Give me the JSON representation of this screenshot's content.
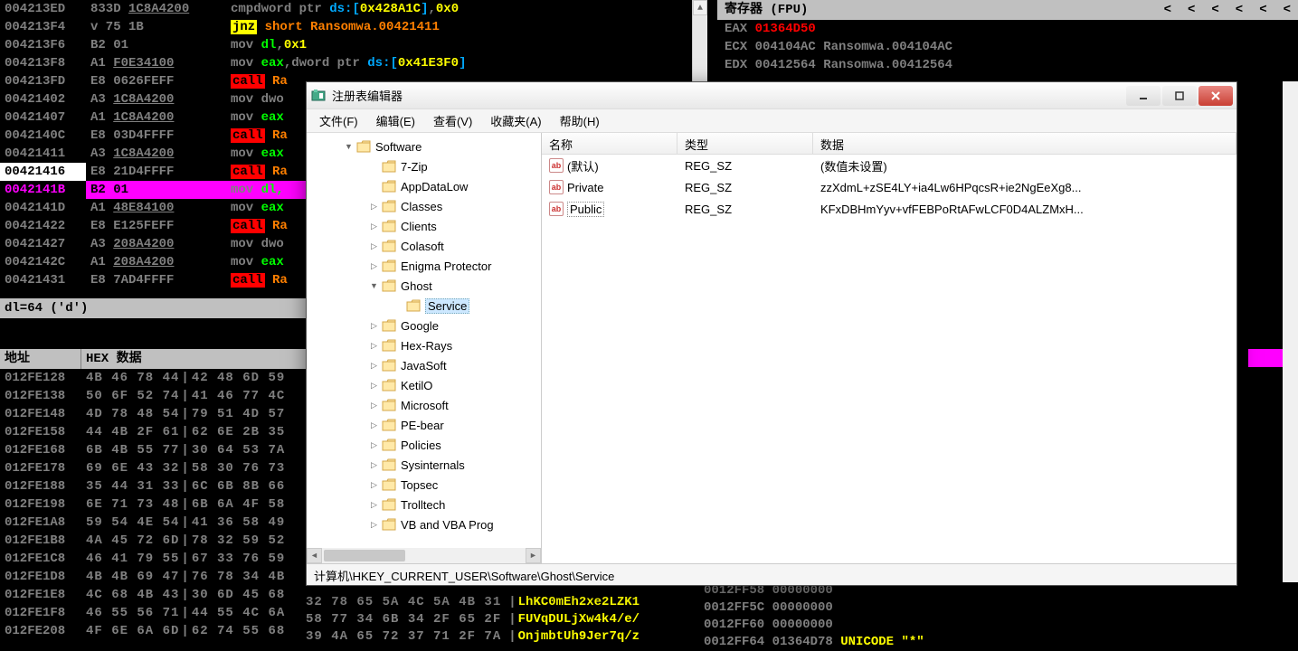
{
  "debugger": {
    "disasm": [
      {
        "addr": "004213ED",
        "mark": "",
        "bytes": "833D 1C8A4200",
        "bytes_ul": "1C8A4200",
        "op": "cmp",
        "op_style": "gray",
        "args": [
          {
            "t": "dword ptr ",
            "c": "gray"
          },
          {
            "t": "ds",
            "c": "blue"
          },
          {
            "t": ":[",
            "c": "blue"
          },
          {
            "t": "0x428A1C",
            "c": "yellow"
          },
          {
            "t": "]",
            "c": "blue"
          },
          {
            "t": ",",
            "c": "gray"
          },
          {
            "t": "0x0",
            "c": "yellow"
          }
        ]
      },
      {
        "addr": "004213F4",
        "mark": "v",
        "bytes": "75 1B",
        "op": "jnz",
        "op_style": "jnz",
        "args": [
          {
            "t": " short Ransomwa.00421411",
            "c": "orange"
          }
        ]
      },
      {
        "addr": "004213F6",
        "bytes": "B2 01",
        "op": "mov",
        "op_style": "gray",
        "args": [
          {
            "t": " dl",
            "c": "green"
          },
          {
            "t": ",",
            "c": "gray"
          },
          {
            "t": "0x1",
            "c": "yellow"
          }
        ]
      },
      {
        "addr": "004213F8",
        "bytes": "A1 F0E34100",
        "bytes_ul": "F0E34100",
        "op": "mov",
        "op_style": "gray",
        "args": [
          {
            "t": " eax",
            "c": "green"
          },
          {
            "t": ",",
            "c": "gray"
          },
          {
            "t": "dword ptr ",
            "c": "gray"
          },
          {
            "t": "ds",
            "c": "blue"
          },
          {
            "t": ":[",
            "c": "blue"
          },
          {
            "t": "0x41E3F0",
            "c": "yellow"
          },
          {
            "t": "]",
            "c": "blue"
          }
        ]
      },
      {
        "addr": "004213FD",
        "bytes": "E8 0626FEFF",
        "op": "call",
        "op_style": "call",
        "args": [
          {
            "t": " Ra",
            "c": "orange"
          }
        ]
      },
      {
        "addr": "00421402",
        "bytes": "A3 1C8A4200",
        "bytes_ul": "1C8A4200",
        "op": "mov",
        "op_style": "gray",
        "args": [
          {
            "t": " dwo",
            "c": "gray"
          }
        ]
      },
      {
        "addr": "00421407",
        "bytes": "A1 1C8A4200",
        "bytes_ul": "1C8A4200",
        "op": "mov",
        "op_style": "gray",
        "args": [
          {
            "t": " eax",
            "c": "green"
          }
        ]
      },
      {
        "addr": "0042140C",
        "bytes": "E8 03D4FFFF",
        "op": "call",
        "op_style": "call",
        "args": [
          {
            "t": " Ra",
            "c": "orange"
          }
        ]
      },
      {
        "addr": "00421411",
        "bytes": "A3 1C8A4200",
        "bytes_ul": "1C8A4200",
        "op": "mov",
        "op_style": "gray",
        "args": [
          {
            "t": " eax",
            "c": "green"
          }
        ]
      },
      {
        "addr": "00421416",
        "sel": "white",
        "bytes": "E8 21D4FFFF",
        "op": "call",
        "op_style": "call",
        "args": [
          {
            "t": " Ra",
            "c": "orange"
          }
        ]
      },
      {
        "addr": "0042141B",
        "sel": "pink",
        "bytes": "B2 01",
        "op": "mov",
        "op_style": "gray",
        "args": [
          {
            "t": " dl,",
            "c": "green"
          }
        ]
      },
      {
        "addr": "0042141D",
        "bytes": "A1 48E84100",
        "bytes_ul": "48E84100",
        "op": "mov",
        "op_style": "gray",
        "args": [
          {
            "t": " eax",
            "c": "green"
          }
        ]
      },
      {
        "addr": "00421422",
        "bytes": "E8 E125FEFF",
        "op": "call",
        "op_style": "call",
        "args": [
          {
            "t": " Ra",
            "c": "orange"
          }
        ]
      },
      {
        "addr": "00421427",
        "bytes": "A3 208A4200",
        "bytes_ul": "208A4200",
        "op": "mov",
        "op_style": "gray",
        "args": [
          {
            "t": " dwo",
            "c": "gray"
          }
        ]
      },
      {
        "addr": "0042142C",
        "bytes": "A1 208A4200",
        "bytes_ul": "208A4200",
        "op": "mov",
        "op_style": "gray",
        "args": [
          {
            "t": " eax",
            "c": "green"
          }
        ]
      },
      {
        "addr": "00421431",
        "bytes": "E8 7AD4FFFF",
        "op": "call",
        "op_style": "call",
        "args": [
          {
            "t": " Ra",
            "c": "orange"
          }
        ]
      }
    ],
    "status_line": "dl=64 ('d')",
    "hex_header": {
      "addr": "地址",
      "data": "HEX 数据"
    },
    "hex_rows": [
      {
        "addr": "012FE128",
        "b1": "4B 46 78 44",
        "b2": "42 48 6D 59"
      },
      {
        "addr": "012FE138",
        "b1": "50 6F 52 74",
        "b2": "41 46 77 4C"
      },
      {
        "addr": "012FE148",
        "b1": "4D 78 48 54",
        "b2": "79 51 4D 57"
      },
      {
        "addr": "012FE158",
        "b1": "44 4B 2F 61",
        "b2": "62 6E 2B 35"
      },
      {
        "addr": "012FE168",
        "b1": "6B 4B 55 77",
        "b2": "30 64 53 7A"
      },
      {
        "addr": "012FE178",
        "b1": "69 6E 43 32",
        "b2": "58 30 76 73"
      },
      {
        "addr": "012FE188",
        "b1": "35 44 31 33",
        "b2": "6C 6B 8B 66"
      },
      {
        "addr": "012FE198",
        "b1": "6E 71 73 48",
        "b2": "6B 6A 4F 58"
      },
      {
        "addr": "012FE1A8",
        "b1": "59 54 4E 54",
        "b2": "41 36 58 49"
      },
      {
        "addr": "012FE1B8",
        "b1": "4A 45 72 6D",
        "b2": "78 32 59 52"
      },
      {
        "addr": "012FE1C8",
        "b1": "46 41 79 55",
        "b2": "67 33 76 59"
      },
      {
        "addr": "012FE1D8",
        "b1": "4B 4B 69 47",
        "b2": "76 78 34 4B"
      },
      {
        "addr": "012FE1E8",
        "b1": "4C 68 4B 43",
        "b2": "30 6D 45 68"
      },
      {
        "addr": "012FE1F8",
        "b1": "46 55 56 71",
        "b2": "44 55 4C 6A"
      },
      {
        "addr": "012FE208",
        "b1": "4F 6E 6A 6D",
        "b2": "62 74 55 68"
      }
    ],
    "registers": {
      "title": "寄存器 (FPU)",
      "nav": [
        "<",
        "<",
        "<",
        "<",
        "<",
        "<"
      ],
      "rows": [
        {
          "name": "EAX",
          "val": "01364D50",
          "val_red": true,
          "desc": ""
        },
        {
          "name": "ECX",
          "val": "004104AC",
          "desc": "Ransomwa.004104AC"
        },
        {
          "name": "EDX",
          "val": "00412564",
          "desc": "Ransomwa.00412564"
        }
      ]
    },
    "stack": [
      {
        "addr": "0012FF58",
        "val": "00000000"
      },
      {
        "addr": "0012FF5C",
        "val": "00000000"
      },
      {
        "addr": "0012FF60",
        "val": "00000000"
      },
      {
        "addr": "0012FF64",
        "val": "01364D78",
        "desc": "UNICODE \"*\""
      }
    ],
    "bottom_dump": [
      {
        "hex": "32 78 65 5A 4C 5A 4B 31",
        "ascii": "LhKC0mEh2xe2LZK1"
      },
      {
        "hex": "58 77 34 6B 34 2F 65 2F",
        "ascii": "FUVqDULjXw4k4/e/"
      },
      {
        "hex": "39 4A 65 72 37 71 2F 7A",
        "ascii": "OnjmbtUh9Jer7q/z"
      }
    ]
  },
  "regedit": {
    "title": "注册表编辑器",
    "menus": [
      "文件(F)",
      "编辑(E)",
      "查看(V)",
      "收藏夹(A)",
      "帮助(H)"
    ],
    "tree": [
      {
        "level": 1,
        "expand": "▼",
        "label": "Software"
      },
      {
        "level": 2,
        "expand": "",
        "label": "7-Zip"
      },
      {
        "level": 2,
        "expand": "",
        "label": "AppDataLow"
      },
      {
        "level": 2,
        "expand": "▷",
        "label": "Classes"
      },
      {
        "level": 2,
        "expand": "▷",
        "label": "Clients"
      },
      {
        "level": 2,
        "expand": "▷",
        "label": "Colasoft"
      },
      {
        "level": 2,
        "expand": "▷",
        "label": "Enigma Protector"
      },
      {
        "level": 2,
        "expand": "▼",
        "label": "Ghost"
      },
      {
        "level": 3,
        "expand": "",
        "label": "Service",
        "selected": true
      },
      {
        "level": 2,
        "expand": "▷",
        "label": "Google"
      },
      {
        "level": 2,
        "expand": "▷",
        "label": "Hex-Rays"
      },
      {
        "level": 2,
        "expand": "▷",
        "label": "JavaSoft"
      },
      {
        "level": 2,
        "expand": "▷",
        "label": "KetilO"
      },
      {
        "level": 2,
        "expand": "▷",
        "label": "Microsoft"
      },
      {
        "level": 2,
        "expand": "▷",
        "label": "PE-bear"
      },
      {
        "level": 2,
        "expand": "▷",
        "label": "Policies"
      },
      {
        "level": 2,
        "expand": "▷",
        "label": "Sysinternals"
      },
      {
        "level": 2,
        "expand": "▷",
        "label": "Topsec"
      },
      {
        "level": 2,
        "expand": "▷",
        "label": "Trolltech"
      },
      {
        "level": 2,
        "expand": "▷",
        "label": "VB and VBA Prog"
      }
    ],
    "list_headers": {
      "name": "名称",
      "type": "类型",
      "data": "数据"
    },
    "list_rows": [
      {
        "name": "(默认)",
        "type": "REG_SZ",
        "data": "(数值未设置)"
      },
      {
        "name": "Private",
        "type": "REG_SZ",
        "data": "zzXdmL+zSE4LY+ia4Lw6HPqcsR+ie2NgEeXg8..."
      },
      {
        "name": "Public",
        "type": "REG_SZ",
        "data": "KFxDBHmYyv+vfFEBPoRtAFwLCF0D4ALZMxH...",
        "focus": true
      }
    ],
    "statusbar": "计算机\\HKEY_CURRENT_USER\\Software\\Ghost\\Service"
  }
}
